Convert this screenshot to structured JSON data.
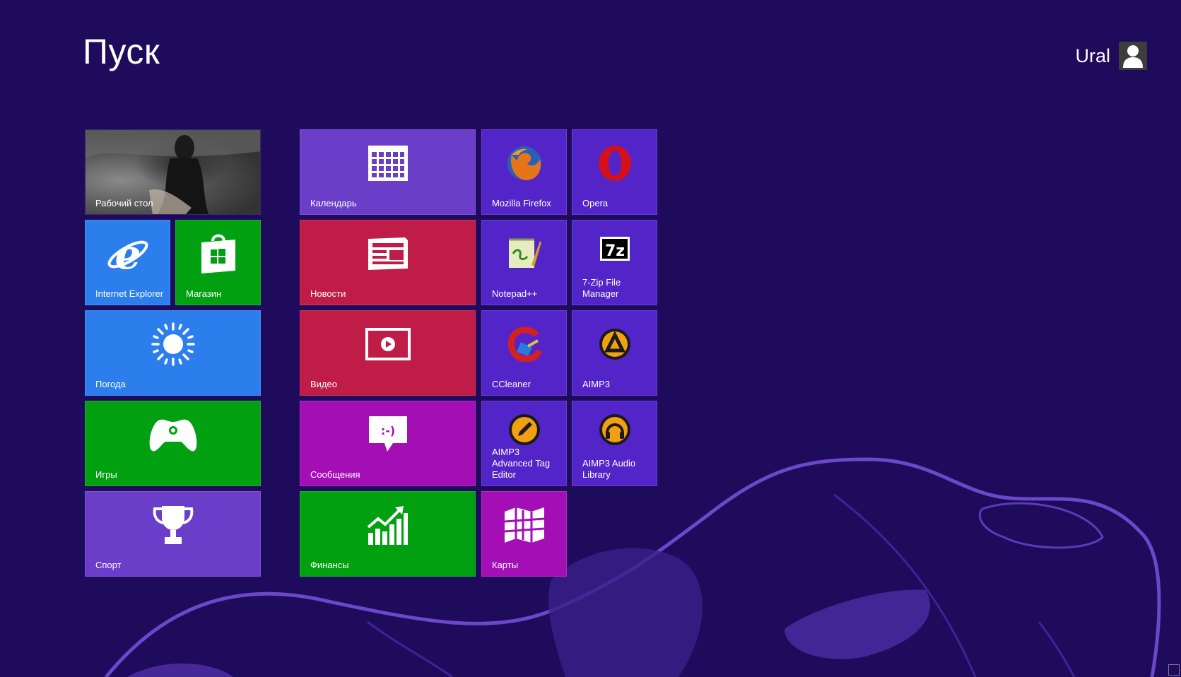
{
  "start": {
    "title": "Пуск"
  },
  "user": {
    "name": "Ural"
  },
  "colors": {
    "background": "#1e0b5c",
    "blue": "#2b7eec",
    "green": "#00a010",
    "purple_tile": "#6a3ec9",
    "red": "#c01c48",
    "magenta": "#a30fb5",
    "app_tile": "#5325c9"
  },
  "tiles": {
    "desktop": {
      "label": "Рабочий стол"
    },
    "ie": {
      "label": "Internet Explorer",
      "icon": "internet-explorer-icon"
    },
    "store": {
      "label": "Магазин",
      "icon": "store-icon"
    },
    "weather": {
      "label": "Погода",
      "icon": "sun-icon"
    },
    "games": {
      "label": "Игры",
      "icon": "gamepad-icon"
    },
    "sport": {
      "label": "Спорт",
      "icon": "trophy-icon"
    },
    "calendar": {
      "label": "Календарь",
      "icon": "calendar-icon"
    },
    "news": {
      "label": "Новости",
      "icon": "newspaper-icon"
    },
    "video": {
      "label": "Видео",
      "icon": "video-icon"
    },
    "messages": {
      "label": "Сообщения",
      "icon": "chat-icon"
    },
    "finance": {
      "label": "Финансы",
      "icon": "chart-icon"
    },
    "firefox": {
      "label": "Mozilla Firefox",
      "icon": "firefox-icon"
    },
    "opera": {
      "label": "Opera",
      "icon": "opera-icon"
    },
    "notepadpp": {
      "label": "Notepad++",
      "icon": "notepad-plus-plus-icon"
    },
    "sevenzip": {
      "label": "7-Zip File Manager",
      "icon": "7zip-icon"
    },
    "ccleaner": {
      "label": "CCleaner",
      "icon": "ccleaner-icon"
    },
    "aimp3": {
      "label": "AIMP3",
      "icon": "aimp-icon"
    },
    "aimp_tag": {
      "label": "AIMP3 Advanced Tag Editor",
      "icon": "aimp-tag-editor-icon"
    },
    "aimp_lib": {
      "label": "AIMP3 Audio Library",
      "icon": "aimp-audio-library-icon"
    },
    "maps": {
      "label": "Карты",
      "icon": "map-icon"
    }
  }
}
